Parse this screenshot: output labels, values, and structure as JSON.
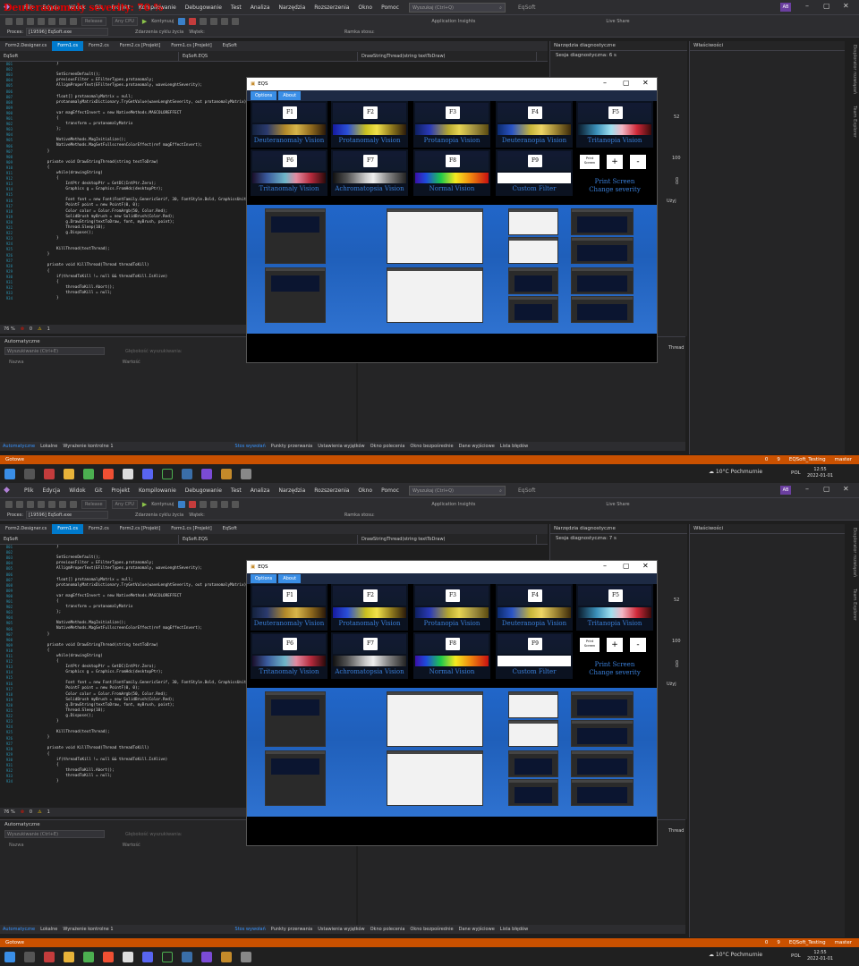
{
  "overlay_title": "Deuteranomaly severity: 70 %",
  "ide": {
    "menu": [
      "Plik",
      "Edycja",
      "Widok",
      "Git",
      "Projekt",
      "Kompilowanie",
      "Debugowanie",
      "Test",
      "Analiza",
      "Narzędzia",
      "Rozszerzenia",
      "Okno",
      "Pomoc"
    ],
    "search_placeholder": "Wyszukaj (Ctrl+Q)",
    "solution": "EqSoft",
    "avatar": "AB",
    "toolbar": {
      "config": "Release",
      "platform": "Any CPU",
      "continue": "Kontynuuj",
      "app_insights": "Application Insights",
      "live_share": "Live Share",
      "lifecycle": "Zdarzenia cyklu życia",
      "thread": "Wątek:",
      "stack_frame": "Ramka stosu:"
    },
    "process_label": "Proces:",
    "process_value": "[19596] EqSoft.exe",
    "tabs": [
      "Form2.Designer.cs",
      "Form1.cs",
      "Form2.cs",
      "Form2.cs [Projekt]",
      "Form1.cs [Projekt]",
      "EqSoft"
    ],
    "nav": {
      "project": "EqSoft",
      "class": "EqSoft.EQS",
      "member": "DrawStringThread(string textToDraw)"
    },
    "zoom": "76 %",
    "errors": "0",
    "warnings": "1",
    "code_lines": [
      {
        "n": "801",
        "t": "            }"
      },
      {
        "n": "802",
        "t": ""
      },
      {
        "n": "803",
        "t": "            SetScreenDefault();"
      },
      {
        "n": "804",
        "t": "            previousFilter = EFilterTypes.protanomaly;"
      },
      {
        "n": "805",
        "t": "            AlligmProperText(EFilterTypes.protanomaly, waveLenghtSeverity);"
      },
      {
        "n": "806",
        "t": ""
      },
      {
        "n": "807",
        "t": "            float[] protanomalyMatrix = null;"
      },
      {
        "n": "808",
        "t": "            protanomalyMatrixDictionary.TryGetValue(waveLenghtSeverity, out protanomalyMatrix);"
      },
      {
        "n": "809",
        "t": ""
      },
      {
        "n": "900",
        "t": "            var magEffectInvert = new NativeMethods.MAGCOLOREFFECT"
      },
      {
        "n": "901",
        "t": "            {"
      },
      {
        "n": "902",
        "t": "                transform = protanomalyMatrix"
      },
      {
        "n": "903",
        "t": "            };"
      },
      {
        "n": "904",
        "t": ""
      },
      {
        "n": "905",
        "t": "            NativeMethods.MagInitialize();"
      },
      {
        "n": "906",
        "t": "            NativeMethods.MagSetFullscreenColorEffect(ref magEffectInvert);"
      },
      {
        "n": "907",
        "t": "        }"
      },
      {
        "n": "908",
        "t": ""
      },
      {
        "n": "909",
        "t": "        private void DrawStringThread(string textToDraw)"
      },
      {
        "n": "910",
        "t": "        {"
      },
      {
        "n": "911",
        "t": "            while(drawingString)"
      },
      {
        "n": "912",
        "t": "            {"
      },
      {
        "n": "913",
        "t": "                IntPtr desktopPtr = GetDC(IntPtr.Zero);"
      },
      {
        "n": "914",
        "t": "                Graphics g = Graphics.FromHdc(desktopPtr);"
      },
      {
        "n": "915",
        "t": ""
      },
      {
        "n": "916",
        "t": "                Font font = new Font(FontFamily.GenericSerif, 30, FontStyle.Bold, GraphicsUnit.Pixel);"
      },
      {
        "n": "917",
        "t": "                PointF point = new PointF(0, 0);"
      },
      {
        "n": "918",
        "t": "                Color color = Color.FromArgb(50, Color.Red);"
      },
      {
        "n": "919",
        "t": "                SolidBrush myBrush = new SolidBrush(Color.Red);"
      },
      {
        "n": "920",
        "t": "                g.DrawString(textToDraw, font, myBrush, point);"
      },
      {
        "n": "921",
        "t": "                Thread.Sleep(10);"
      },
      {
        "n": "922",
        "t": "                g.Dispose();"
      },
      {
        "n": "923",
        "t": "            }"
      },
      {
        "n": "924",
        "t": ""
      },
      {
        "n": "925",
        "t": "            KillThread(textThread);"
      },
      {
        "n": "926",
        "t": "        }"
      },
      {
        "n": "927",
        "t": ""
      },
      {
        "n": "928",
        "t": "        private void KillThread(Thread threadToKill)"
      },
      {
        "n": "929",
        "t": "        {"
      },
      {
        "n": "930",
        "t": "            if(threadToKill != null && threadToKill.IsAlive)"
      },
      {
        "n": "931",
        "t": "            {"
      },
      {
        "n": "932",
        "t": "                threadToKill.Abort();"
      },
      {
        "n": "933",
        "t": "                threadToKill = null;"
      },
      {
        "n": "934",
        "t": "            }"
      }
    ],
    "autos_title": "Automatyczne",
    "autos_search": "Wyszukiwanie (Ctrl+E)",
    "autos_depth": "Głębokość wyszukiwania:",
    "autos_cols": [
      "Nazwa",
      "Wartość"
    ],
    "bottom_tabs_left": [
      "Automatyczne",
      "Lokalne",
      "Wyrażenie kontrolne 1"
    ],
    "bottom_tabs_right": [
      "Stos wywołań",
      "Punkty przerwania",
      "Ustawienia wyjątków",
      "Okno polecenia",
      "Okno bezpośrednie",
      "Dane wyjściowe",
      "Lista błędów"
    ],
    "diag_title": "Narzędzia diagnostyczne",
    "diag_sessions": [
      "Sesja diagnostyczna: 6 s",
      "Sesja diagnostyczna: 7 s"
    ],
    "diag_ticks": [
      "52",
      "0",
      "100",
      "0"
    ],
    "diag_use": "Użyj",
    "diag_threads": "Thread",
    "props_title": "Właściwości",
    "side_tabs": [
      "Eksplorator rozwiązań",
      "Team Explorer"
    ],
    "status_ready": "Gotowe",
    "status_right": {
      "errors": "0",
      "pending": "9",
      "project": "EQSoft_Testing",
      "branch": "master"
    },
    "taskbar": {
      "weather_temp": "10°C",
      "weather_desc": "Pochmurnie",
      "lang": "POL",
      "time": "12:55",
      "date": "2022-01-01"
    }
  },
  "eqs": {
    "title": "EQS",
    "menu": [
      "Options",
      "About"
    ],
    "filters": [
      {
        "key": "F1",
        "label": "Deuteranomaly Vision",
        "grad": "linear-gradient(90deg,#14223d,#2a3a6e 20%,#b38a2a 45%,#d7b54a 60%,#8f6a1e 80%,#2b1a0a)"
      },
      {
        "key": "F2",
        "label": "Protanomaly Vision",
        "grad": "linear-gradient(90deg,#161ba0,#2a50d8 20%,#c9c020 45%,#f1e14a 60%,#8f7a1e 80%,#2a1a0a)"
      },
      {
        "key": "F3",
        "label": "Protanopia Vision",
        "grad": "linear-gradient(90deg,#0e2060,#2a3ab8 20%,#b4a630 45%,#e6d452 60%,#a09040 80%,#5a4a10)"
      },
      {
        "key": "F4",
        "label": "Deuteranopia Vision",
        "grad": "linear-gradient(90deg,#0b2a6c,#2b55c6 20%,#c7b53a 45%,#eed565 60%,#9a8232 80%,#3c2a0a)"
      },
      {
        "key": "F5",
        "label": "Tritanopia Vision",
        "grad": "linear-gradient(90deg,#0a1a2a,#3a8fb8 25%,#9fe0f0 45%,#f2b8c6 60%,#d02a3a 80%,#3a0a0a)"
      },
      {
        "key": "F6",
        "label": "Tritanomaly Vision",
        "grad": "linear-gradient(90deg,#1a0f2a,#3a5a9c 20%,#6fb6c8 45%,#e38aa0 60%,#b42a3c 80%,#2a0a0a)"
      },
      {
        "key": "F7",
        "label": "Achromatopsia Vision",
        "grad": "linear-gradient(90deg,#111,#555 20%,#ccc 45%,#eee 55%,#888 75%,#222)"
      },
      {
        "key": "F8",
        "label": "Normal Vision",
        "grad": "linear-gradient(90deg,#3a10a8,#1e4bdc 15%,#1dc84a 35%,#f5ea20 55%,#f08a10 75%,#c81010)"
      },
      {
        "key": "F9",
        "label": "Custom Filter",
        "grad": "linear-gradient(90deg,#fff,#fff)"
      }
    ],
    "controls": {
      "print_button": "Print Screen",
      "plus": "+",
      "minus": "-",
      "label_line1": "Print Screen",
      "label_line2": "Change severity"
    },
    "accent": "#3a7fd8"
  }
}
